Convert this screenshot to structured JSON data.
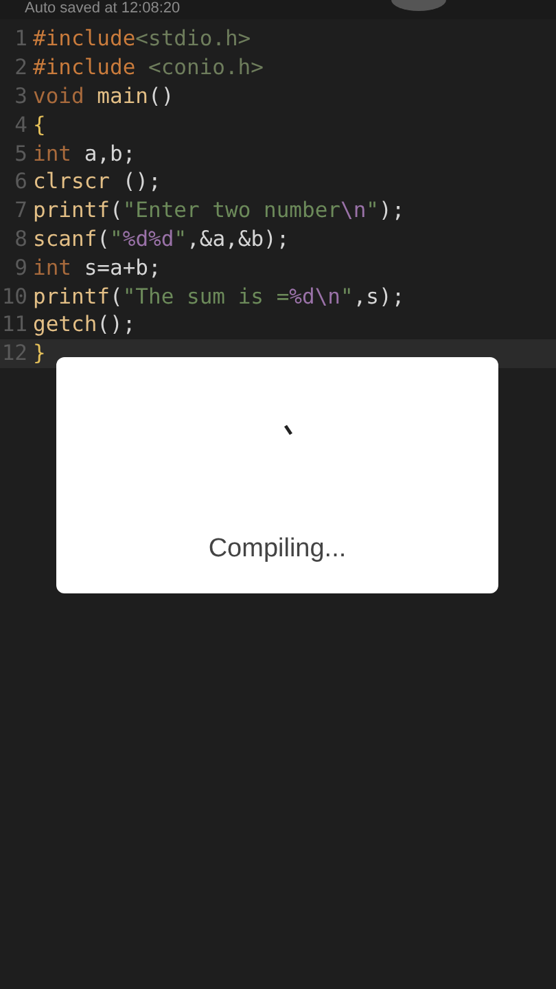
{
  "status": {
    "text": "Auto saved at 12:08:20"
  },
  "editor": {
    "lines": [
      {
        "number": "1",
        "current": false,
        "tokens": [
          {
            "kind": "pre",
            "text": "#include"
          },
          {
            "kind": "hdr",
            "text": "<stdio.h>"
          }
        ]
      },
      {
        "number": "2",
        "current": false,
        "tokens": [
          {
            "kind": "pre",
            "text": "#include"
          },
          {
            "kind": "hdr",
            "text": " <conio.h>"
          }
        ]
      },
      {
        "number": "3",
        "current": false,
        "tokens": [
          {
            "kind": "kw",
            "text": "void"
          },
          {
            "kind": "fn",
            "text": " main"
          },
          {
            "kind": "plain",
            "text": "()"
          }
        ]
      },
      {
        "number": "4",
        "current": false,
        "tokens": [
          {
            "kind": "brace",
            "text": "{"
          }
        ]
      },
      {
        "number": "5",
        "current": false,
        "tokens": [
          {
            "kind": "kw",
            "text": "int"
          },
          {
            "kind": "plain",
            "text": " a,b;"
          }
        ]
      },
      {
        "number": "6",
        "current": false,
        "tokens": [
          {
            "kind": "fn",
            "text": "clrscr"
          },
          {
            "kind": "plain",
            "text": " ();"
          }
        ]
      },
      {
        "number": "7",
        "current": false,
        "tokens": [
          {
            "kind": "fn",
            "text": "printf"
          },
          {
            "kind": "plain",
            "text": "("
          },
          {
            "kind": "str",
            "text": "\"Enter two number"
          },
          {
            "kind": "fmt",
            "text": "\\n"
          },
          {
            "kind": "str",
            "text": "\""
          },
          {
            "kind": "plain",
            "text": ");"
          }
        ]
      },
      {
        "number": "8",
        "current": false,
        "tokens": [
          {
            "kind": "fn",
            "text": "scanf"
          },
          {
            "kind": "plain",
            "text": "("
          },
          {
            "kind": "str",
            "text": "\""
          },
          {
            "kind": "fmt",
            "text": "%d%d"
          },
          {
            "kind": "str",
            "text": "\""
          },
          {
            "kind": "plain",
            "text": ",&a,&b);"
          }
        ]
      },
      {
        "number": "9",
        "current": false,
        "tokens": [
          {
            "kind": "kw",
            "text": "int"
          },
          {
            "kind": "plain",
            "text": " s=a+b;"
          }
        ]
      },
      {
        "number": "10",
        "current": false,
        "tokens": [
          {
            "kind": "fn",
            "text": "printf"
          },
          {
            "kind": "plain",
            "text": "("
          },
          {
            "kind": "str",
            "text": "\"The sum is ="
          },
          {
            "kind": "fmt",
            "text": "%d\\n"
          },
          {
            "kind": "str",
            "text": "\""
          },
          {
            "kind": "plain",
            "text": ",s);"
          }
        ]
      },
      {
        "number": "11",
        "current": false,
        "tokens": [
          {
            "kind": "fn",
            "text": "getch"
          },
          {
            "kind": "plain",
            "text": "();"
          }
        ]
      },
      {
        "number": "12",
        "current": true,
        "tokens": [
          {
            "kind": "brace",
            "text": "}"
          }
        ]
      }
    ]
  },
  "dialog": {
    "message": "Compiling..."
  }
}
